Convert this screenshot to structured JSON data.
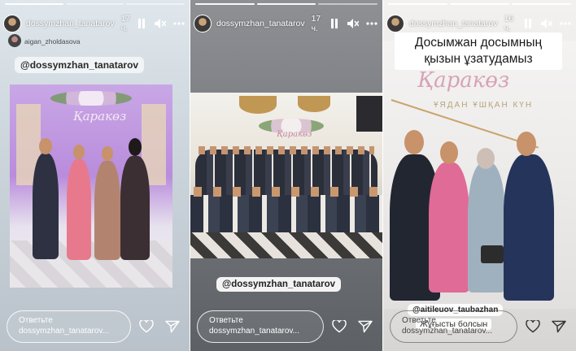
{
  "stories": [
    {
      "username": "dossymzhan_tanatarov",
      "time_ago": "17 ч.",
      "mention_small": "aigan_zholdasova",
      "tag": "@dossymzhan_tanatarov",
      "backdrop_text": "Қаракөз",
      "reply_placeholder": "Ответьте dossymzhan_tanatarov..."
    },
    {
      "username": "dossymzhan_tanatarov",
      "time_ago": "17 ч.",
      "tag": "@dossymzhan_tanatarov",
      "backdrop_text": "Қаракөз",
      "reply_placeholder": "Ответьте dossymzhan_tanatarov..."
    },
    {
      "username": "dossymzhan_tanatarov",
      "time_ago": "16 ч.",
      "headline": "Досымжан досымның қызын ұзатудамыз",
      "backdrop_text": "Қаракөз",
      "backdrop_sub": "ҰЯДАН ҰШҚАН КҮН",
      "tag": "@aitileuov_taubazhan",
      "caption": "Жұғысты болсын",
      "reply_placeholder": "Ответьте dossymzhan_tanatarov..."
    }
  ],
  "icons": {
    "pause": "pause-icon",
    "mute": "mute-icon",
    "more": "more-icon",
    "like": "heart-icon",
    "share": "send-icon"
  }
}
